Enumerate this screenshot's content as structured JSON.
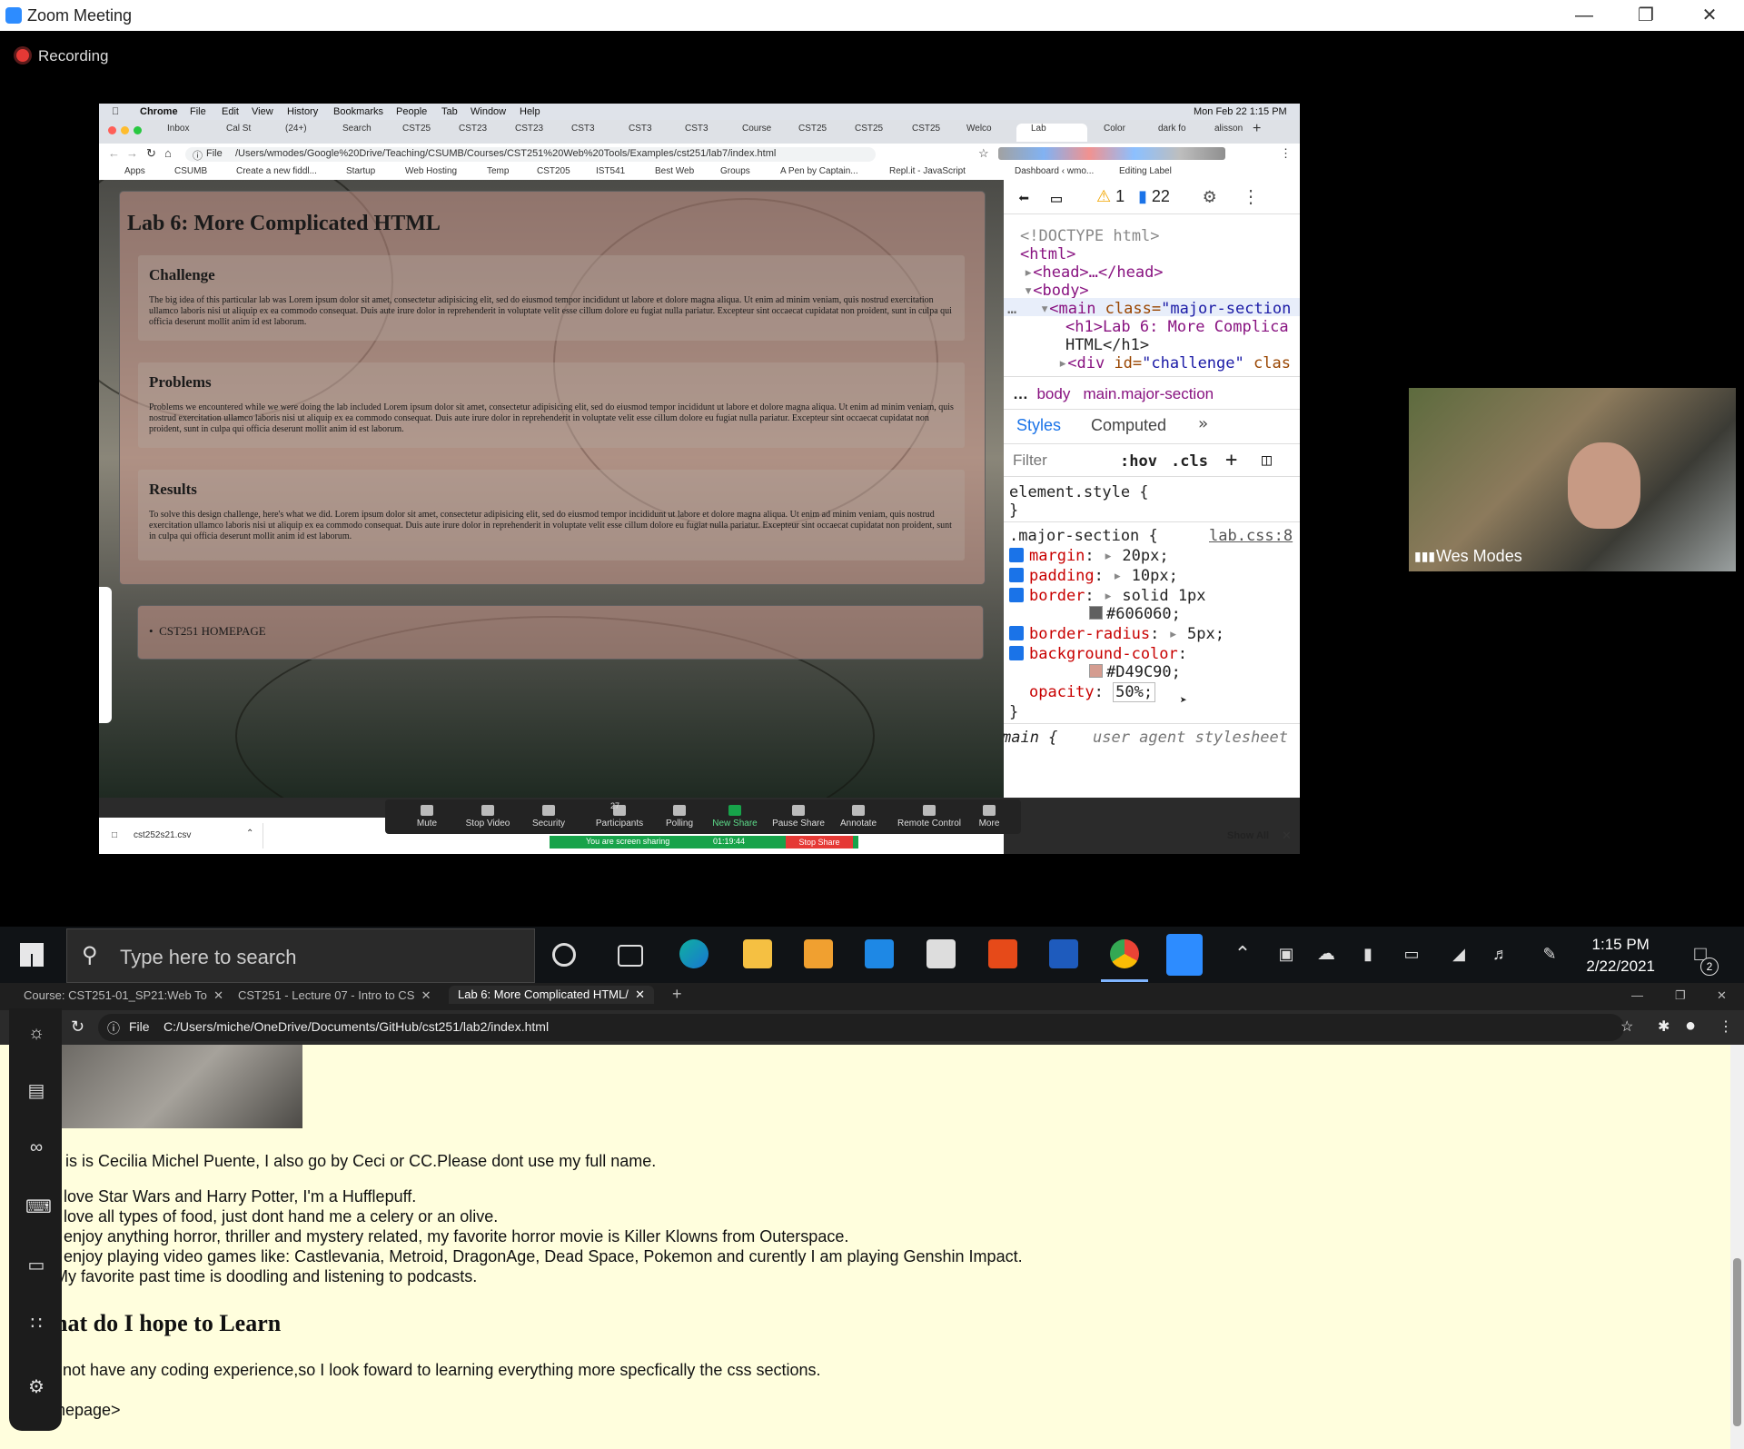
{
  "zoom": {
    "window_title": "Zoom Meeting",
    "recording_label": "Recording",
    "participant_name": "Wes Modes"
  },
  "mac": {
    "menu": [
      "Chrome",
      "File",
      "Edit",
      "View",
      "History",
      "Bookmarks",
      "People",
      "Tab",
      "Window",
      "Help"
    ],
    "datetime": "Mon Feb 22  1:15 PM"
  },
  "shared_chrome": {
    "tabs": [
      "Inbox",
      "Cal St",
      "(24+)",
      "Search",
      "CST25",
      "CST23",
      "CST23",
      "CST3",
      "CST3",
      "CST3",
      "Course",
      "CST25",
      "CST25",
      "CST25",
      "Welco",
      "Lab",
      "Color",
      "dark fo",
      "alisson"
    ],
    "address": "/Users/wmodes/Google%20Drive/Teaching/CSUMB/Courses/CST251%20Web%20Tools/Examples/cst251/lab7/index.html",
    "address_prefix": "File",
    "bookmarks": [
      "Apps",
      "CSUMB",
      "Create a new fiddl...",
      "Startup",
      "Web Hosting",
      "Temp",
      "CST205",
      "IST541",
      "Best Web",
      "Groups",
      "A Pen by Captain...",
      "Repl.it - JavaScript",
      "Dashboard ‹ wmo...",
      "Editing Label"
    ]
  },
  "lab_page": {
    "title": "Lab 6: More Complicated HTML",
    "sections": [
      {
        "heading": "Challenge",
        "body": "The big idea of this particular lab was Lorem ipsum dolor sit amet, consectetur adipisicing elit, sed do eiusmod tempor incididunt ut labore et dolore magna aliqua. Ut enim ad minim veniam, quis nostrud exercitation ullamco laboris nisi ut aliquip ex ea commodo consequat. Duis aute irure dolor in reprehenderit in voluptate velit esse cillum dolore eu fugiat nulla pariatur. Excepteur sint occaecat cupidatat non proident, sunt in culpa qui officia deserunt mollit anim id est laborum."
      },
      {
        "heading": "Problems",
        "body": "Problems we encountered while we were doing the lab included Lorem ipsum dolor sit amet, consectetur adipisicing elit, sed do eiusmod tempor incididunt ut labore et dolore magna aliqua. Ut enim ad minim veniam, quis nostrud exercitation ullamco laboris nisi ut aliquip ex ea commodo consequat. Duis aute irure dolor in reprehenderit in voluptate velit esse cillum dolore eu fugiat nulla pariatur. Excepteur sint occaecat cupidatat non proident, sunt in culpa qui officia deserunt mollit anim id est laborum."
      },
      {
        "heading": "Results",
        "body": "To solve this design challenge, here's what we did. Lorem ipsum dolor sit amet, consectetur adipisicing elit, sed do eiusmod tempor incididunt ut labore et dolore magna aliqua. Ut enim ad minim veniam, quis nostrud exercitation ullamco laboris nisi ut aliquip ex ea commodo consequat. Duis aute irure dolor in reprehenderit in voluptate velit esse cillum dolore eu fugiat nulla pariatur. Excepteur sint occaecat cupidatat non proident, sunt in culpa qui officia deserunt mollit anim id est laborum."
      }
    ],
    "footer_link": "CST251 HOMEPAGE"
  },
  "devtools": {
    "warn_count": "1",
    "msg_count": "22",
    "dom": {
      "doctype": "<!DOCTYPE html>",
      "html": "<html>",
      "head": "<head>…</head>",
      "body": "<body>",
      "main_tag": "<main ",
      "main_attr": "class=",
      "main_val": "\"major-section",
      "h1_line1": "<h1>Lab 6: More Complica",
      "h1_line2": "HTML</h1>",
      "div_tag": "<div ",
      "div_attr": "id=",
      "div_val": "\"challenge\"",
      "div_rest": " clas"
    },
    "breadcrumb": [
      "body",
      "main.major-section"
    ],
    "tabs": [
      "Styles",
      "Computed"
    ],
    "filter_placeholder": "Filter",
    "hov": ":hov",
    "cls": ".cls",
    "element_style": "element.style {",
    "rule_selector": ".major-section {",
    "rule_source": "lab.css:8",
    "props": [
      {
        "name": "margin",
        "value": "20px;"
      },
      {
        "name": "padding",
        "value": "10px;"
      },
      {
        "name": "border",
        "value": "solid 1px"
      },
      {
        "name": "border-radius",
        "value": "5px;"
      },
      {
        "name": "background-color",
        "value": ""
      }
    ],
    "border_color": "#606060;",
    "bg_color": "#D49C90;",
    "opacity_name": "opacity",
    "opacity_value": "50%;",
    "ua_selector": "main {",
    "ua_label": "user agent stylesheet"
  },
  "zoom_toolbar": {
    "items": [
      "Mute",
      "Stop Video",
      "Security",
      "Participants",
      "Polling",
      "New Share",
      "Pause Share",
      "Annotate",
      "Remote Control",
      "More"
    ],
    "participants_count": "27",
    "sharing_text": "You are screen sharing",
    "sharing_time": "01:19:44",
    "stop_share": "Stop Share"
  },
  "download": {
    "file": "cst252s21.csv",
    "show_all": "Show All"
  },
  "taskbar": {
    "search_placeholder": "Type here to search",
    "time": "1:15 PM",
    "date": "2/22/2021",
    "notif_count": "2"
  },
  "local_chrome": {
    "tabs": [
      "Course: CST251-01_SP21:Web To",
      "CST251 - Lecture 07 - Intro to CS",
      "Lab 6: More Complicated HTML/"
    ],
    "address_prefix": "File",
    "address": "C:/Users/miche/OneDrive/Documents/GitHub/cst251/lab2/index.html"
  },
  "local_page": {
    "intro": "is is Cecilia Michel Puente, I also go by Ceci or CC.Please dont use my full name.",
    "list": [
      "I love Star Wars and Harry Potter, I'm a Hufflepuff.",
      "I love all types of food, just dont hand me a celery or an olive.",
      "I enjoy anything horror, thriller and mystery related, my favorite horror movie is Killer Klowns from Outerspace.",
      "I enjoy playing video games like: Castlevania, Metroid, DragonAge, Dead Space, Pokemon and curently I am playing Genshin Impact.",
      "My favorite past time is doodling and listening to podcasts."
    ],
    "heading": "What do I hope to Learn",
    "paragraph": "I do not have any coding experience,so I look foward to learning everything more specfically the css sections.",
    "homepage_link": "Homepage>"
  }
}
